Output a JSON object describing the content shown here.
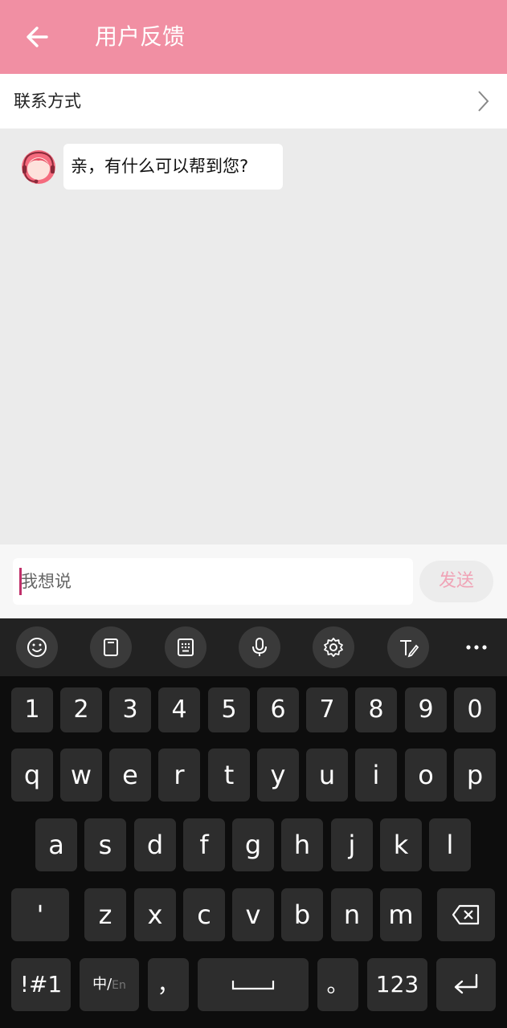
{
  "header": {
    "title": "用户反馈"
  },
  "contact": {
    "label": "联系方式"
  },
  "chat": {
    "messages": [
      {
        "text": "亲，有什么可以帮到您?"
      }
    ]
  },
  "input": {
    "placeholder": "我想说",
    "send_label": "发送"
  },
  "colors": {
    "header": "#f18fa3",
    "send_text": "#f0a3b6",
    "cursor": "#c0306a"
  },
  "keyboard": {
    "toolbar_icons": [
      "emoji-icon",
      "clipboard-icon",
      "keypad-icon",
      "microphone-icon",
      "settings-icon",
      "handwriting-icon",
      "more-icon"
    ],
    "number_row": [
      "1",
      "2",
      "3",
      "4",
      "5",
      "6",
      "7",
      "8",
      "9",
      "0"
    ],
    "row1": [
      "q",
      "w",
      "e",
      "r",
      "t",
      "y",
      "u",
      "i",
      "o",
      "p"
    ],
    "row2": [
      "a",
      "s",
      "d",
      "f",
      "g",
      "h",
      "j",
      "k",
      "l"
    ],
    "row3": [
      "'",
      "z",
      "x",
      "c",
      "v",
      "b",
      "n",
      "m"
    ],
    "symbols_label": "!#1",
    "lang_main": "中/",
    "lang_sub": "En",
    "comma": "，",
    "period": "。",
    "numeric_label": "123"
  }
}
